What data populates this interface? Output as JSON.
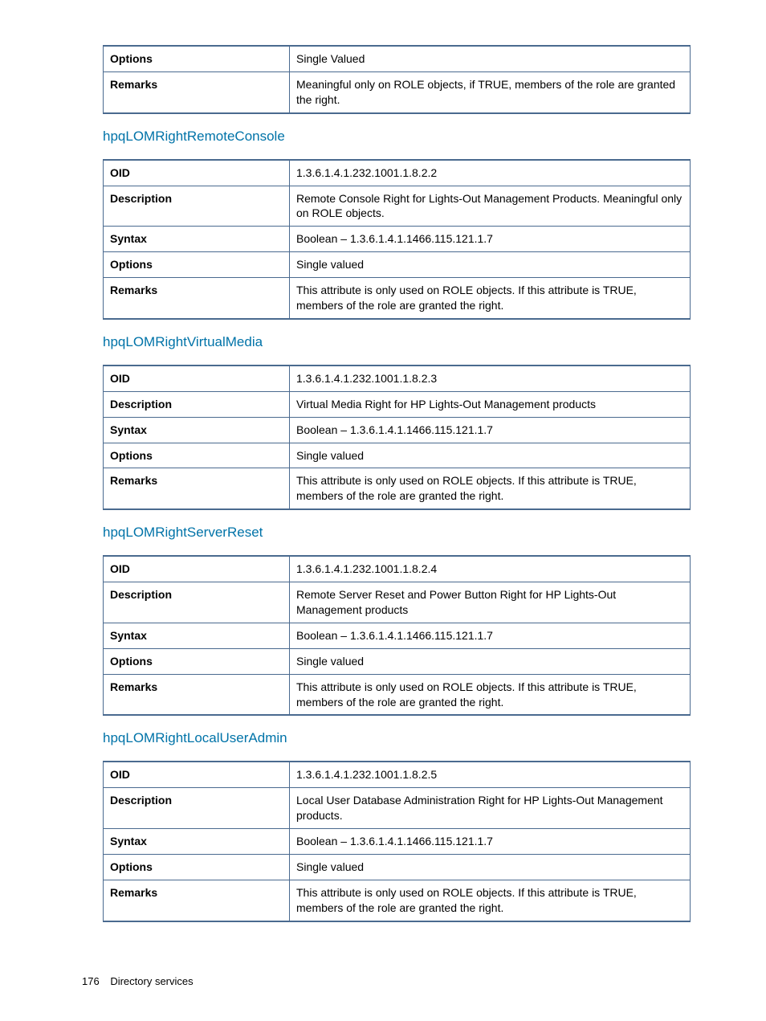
{
  "row_labels": {
    "oid": "OID",
    "description": "Description",
    "syntax": "Syntax",
    "options": "Options",
    "remarks": "Remarks"
  },
  "top_partial_table": {
    "options": "Single Valued",
    "remarks": "Meaningful only on ROLE objects, if TRUE, members of the role are granted the right."
  },
  "sections": [
    {
      "heading": "hpqLOMRightRemoteConsole",
      "oid": "1.3.6.1.4.1.232.1001.1.8.2.2",
      "description": "Remote Console Right for Lights-Out Management Products. Meaningful only on ROLE objects.",
      "syntax": "Boolean – 1.3.6.1.4.1.1466.115.121.1.7",
      "options": "Single valued",
      "remarks": "This attribute is only used on ROLE objects. If this attribute is TRUE, members of the role are granted the right."
    },
    {
      "heading": "hpqLOMRightVirtualMedia",
      "oid": "1.3.6.1.4.1.232.1001.1.8.2.3",
      "description": "Virtual Media Right for HP Lights-Out Management products",
      "syntax": "Boolean – 1.3.6.1.4.1.1466.115.121.1.7",
      "options": "Single valued",
      "remarks": "This attribute is only used on ROLE objects. If this attribute is TRUE, members of the role are granted the right."
    },
    {
      "heading": "hpqLOMRightServerReset",
      "oid": "1.3.6.1.4.1.232.1001.1.8.2.4",
      "description": "Remote Server Reset and Power Button Right for HP Lights-Out Management products",
      "syntax": "Boolean – 1.3.6.1.4.1.1466.115.121.1.7",
      "options": "Single valued",
      "remarks": "This attribute is only used on ROLE objects. If this attribute is TRUE, members of the role are granted the right."
    },
    {
      "heading": "hpqLOMRightLocalUserAdmin",
      "oid": "1.3.6.1.4.1.232.1001.1.8.2.5",
      "description": "Local User Database Administration Right for HP Lights-Out Management products.",
      "syntax": "Boolean – 1.3.6.1.4.1.1466.115.121.1.7",
      "options": "Single valued",
      "remarks": "This attribute is only used on ROLE objects. If this attribute is TRUE, members of the role are granted the right."
    }
  ],
  "footer": {
    "page_number": "176",
    "section": "Directory services"
  }
}
